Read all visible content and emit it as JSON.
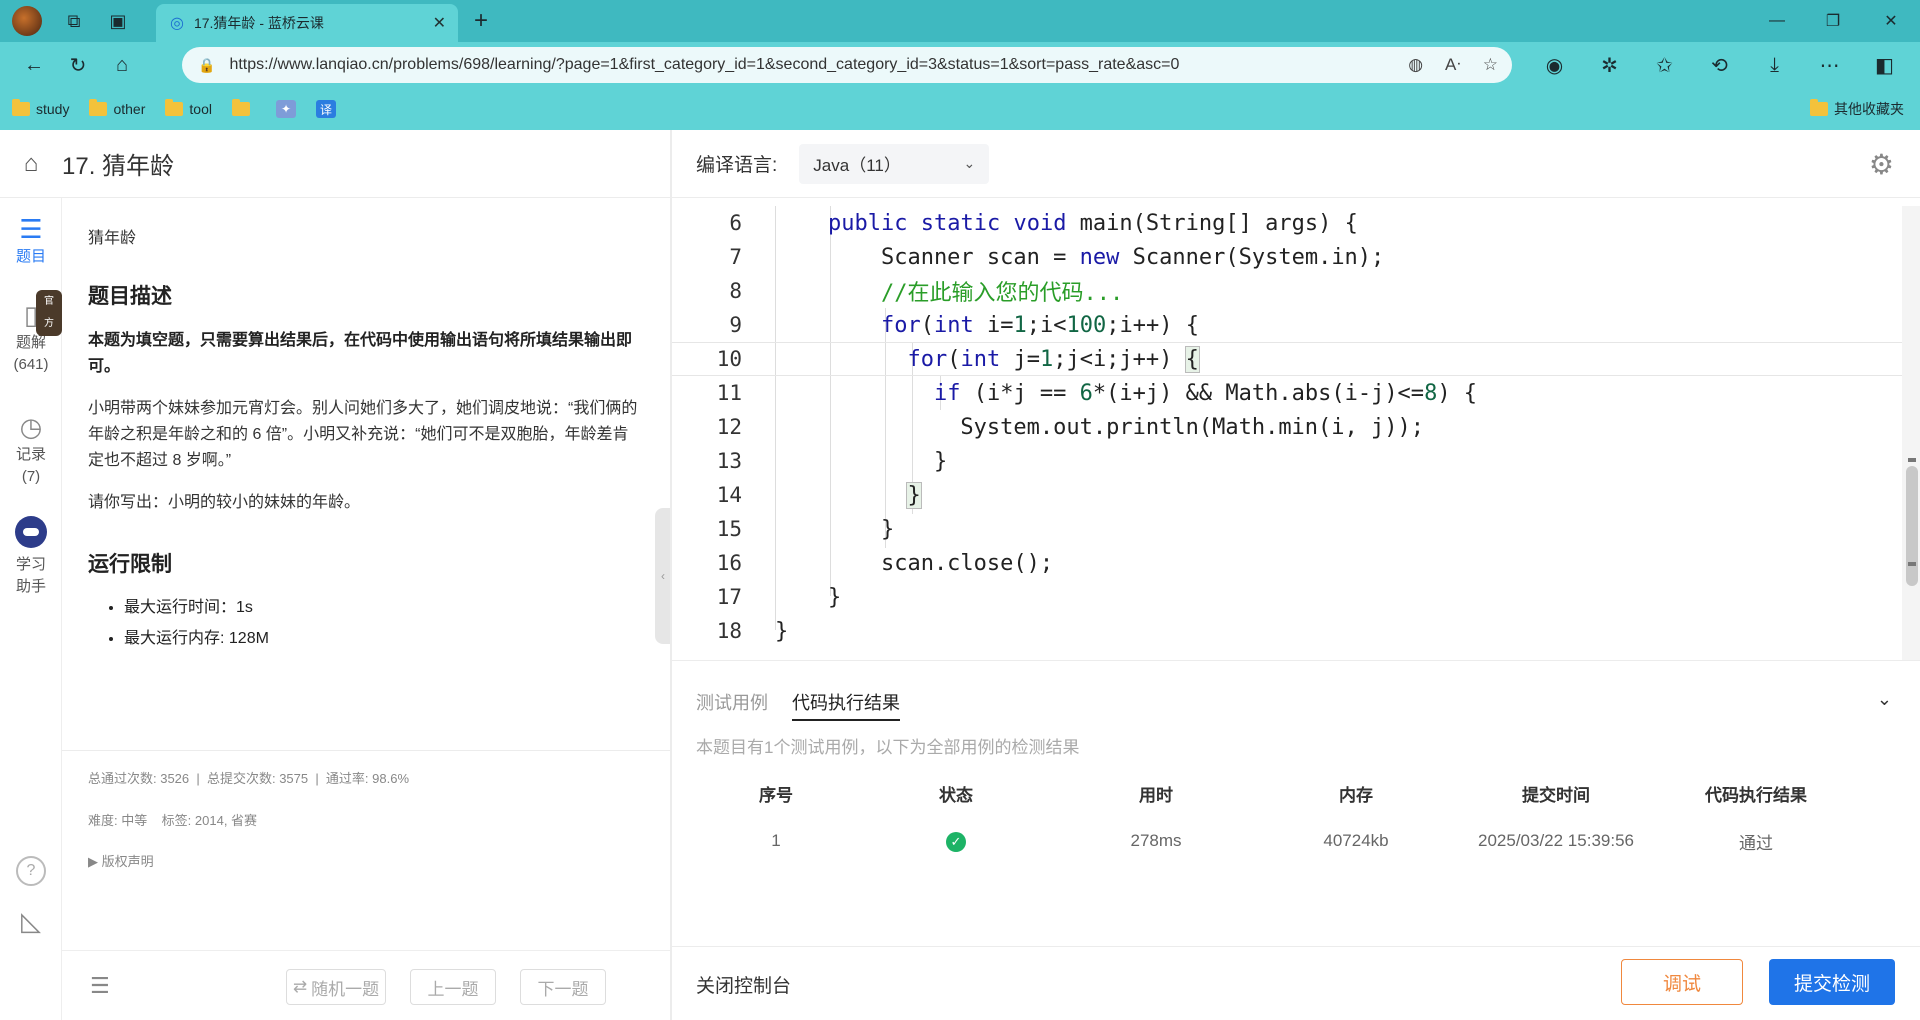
{
  "browser": {
    "tab_title": "17.猜年龄 - 蓝桥云课",
    "url": "https://www.lanqiao.cn/problems/698/learning/?page=1&first_category_id=1&second_category_id=3&status=1&sort=pass_rate&asc=0",
    "bookmarks": [
      "study",
      "other",
      "tool"
    ],
    "bookmark_translate_label": "译",
    "other_bookmarks": "其他收藏夹"
  },
  "left": {
    "title": "17. 猜年龄",
    "sidebar": {
      "problem": "题目",
      "solutions": "题解",
      "solutions_count": "(641)",
      "official_badge": "官方",
      "records": "记录",
      "records_count": "(7)",
      "assistant_line1": "学习",
      "assistant_line2": "助手"
    },
    "crumb": "猜年龄",
    "desc_heading": "题目描述",
    "desc_bold": "本题为填空题，只需要算出结果后，在代码中使用输出语句将所填结果输出即可。",
    "desc_p1": "小明带两个妹妹参加元宵灯会。别人问她们多大了，她们调皮地说：“我们俩的年龄之积是年龄之和的 6 倍”。小明又补充说：“她们可不是双胞胎，年龄差肯定也不超过 8 岁啊。”",
    "desc_p2": "请你写出：小明的较小的妹妹的年龄。",
    "limit_heading": "运行限制",
    "limits": [
      "最大运行时间：1s",
      "最大运行内存: 128M"
    ],
    "stats": "总通过次数: 3526  |  总提交次数: 3575  |  通过率: 98.6%",
    "meta": "难度: 中等    标签: 2014, 省赛",
    "copyright": "▶ 版权声明",
    "footer": {
      "random": "随机一题",
      "prev": "上一题",
      "next": "下一题"
    }
  },
  "right": {
    "lang_label": "编译语言:",
    "lang_value": "Java（11）",
    "code": {
      "line_numbers": [
        "6",
        "7",
        "8",
        "9",
        "10",
        "11",
        "12",
        "13",
        "14",
        "15",
        "16",
        "17",
        "18"
      ]
    },
    "console": {
      "tab_testcase": "测试用例",
      "tab_result": "代码执行结果",
      "note": "本题目有1个测试用例，以下为全部用例的检测结果",
      "columns": [
        "序号",
        "状态",
        "用时",
        "内存",
        "提交时间",
        "代码执行结果"
      ],
      "row": {
        "index": "1",
        "time": "278ms",
        "memory": "40724kb",
        "submitted": "2025/03/22 15:39:56",
        "result": "通过"
      }
    },
    "footer": {
      "close_console": "关闭控制台",
      "debug": "调试",
      "submit": "提交检测"
    }
  },
  "colors": {
    "browser_teal": "#5fd3d6",
    "accent_blue": "#1f74e8",
    "debug_orange": "#f0883e",
    "success_green": "#1db366"
  }
}
